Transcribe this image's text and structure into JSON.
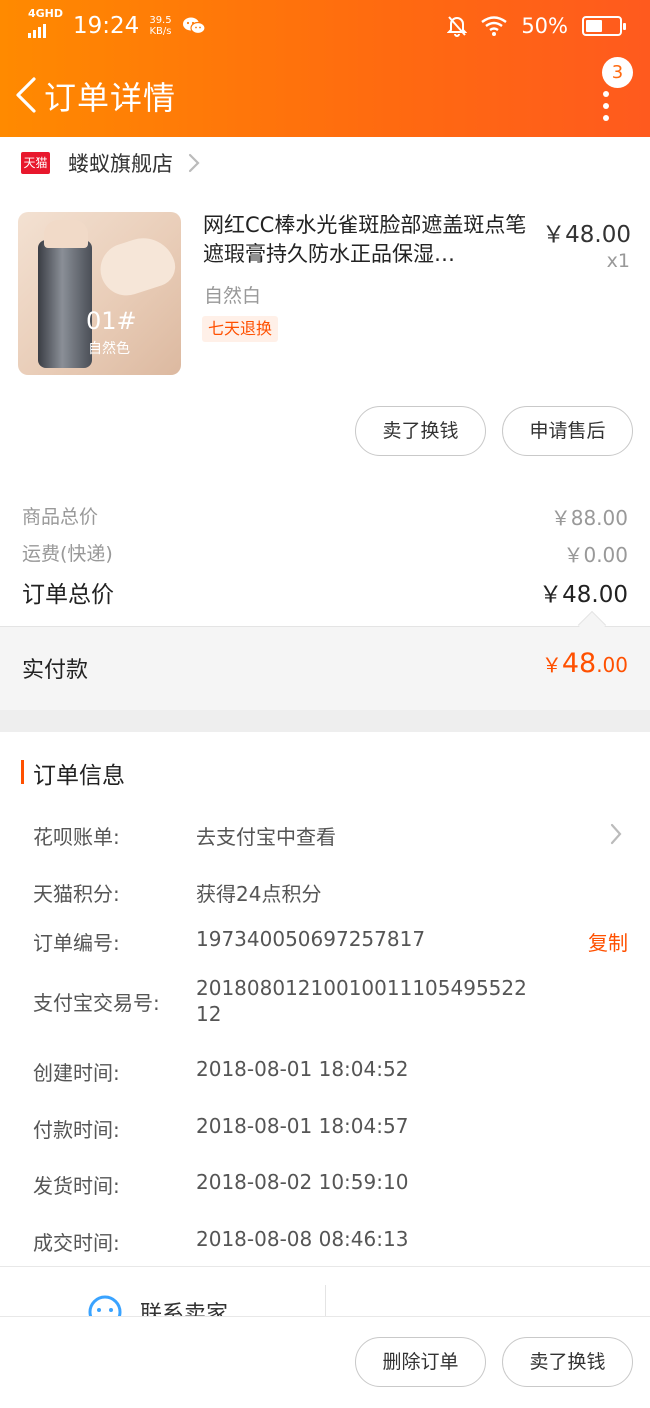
{
  "status_bar": {
    "network": "4GHD",
    "time": "19:24",
    "speed": "39.5",
    "speed_unit": "KB/s",
    "battery": "50%",
    "battery_level": 0.5
  },
  "header": {
    "title": "订单详情",
    "badge_count": "3"
  },
  "shop": {
    "badge": "天猫",
    "name": "蝼蚁旗舰店"
  },
  "product": {
    "image_number": "01#",
    "image_shade": "自然色",
    "title": "网红CC棒水光雀斑脸部遮盖斑点笔遮瑕膏持久防水正品保湿…",
    "price": "￥48.00",
    "quantity": "x1",
    "spec": "自然白",
    "tag": "七天退换"
  },
  "product_actions": {
    "sell": "卖了换钱",
    "after_sale": "申请售后"
  },
  "summary": {
    "goods_total_label": "商品总价",
    "goods_total_value": "￥88.00",
    "shipping_label": "运费(快递)",
    "shipping_value": "￥0.00",
    "order_total_label": "订单总价",
    "order_total_value": "￥48.00",
    "paid_label": "实付款",
    "paid_currency": "￥",
    "paid_int": "48",
    "paid_dec": ".00"
  },
  "order_info": {
    "title": "订单信息",
    "rows": [
      {
        "label": "花呗账单:",
        "value": "去支付宝中查看"
      },
      {
        "label": "天猫积分:",
        "value": "获得24点积分"
      },
      {
        "label": "订单编号:",
        "value": "197340050697257817"
      },
      {
        "label": "支付宝交易号:",
        "value": "20180801210010011105495522 12"
      },
      {
        "label": "创建时间:",
        "value": "2018-08-01 18:04:52"
      },
      {
        "label": "付款时间:",
        "value": "2018-08-01 18:04:57"
      },
      {
        "label": "发货时间:",
        "value": "2018-08-02 10:59:10"
      },
      {
        "label": "成交时间:",
        "value": "2018-08-08 08:46:13"
      }
    ],
    "copy": "复制"
  },
  "contact": {
    "label": "联系卖家"
  },
  "bottom_bar": {
    "delete": "删除订单",
    "sell": "卖了换钱"
  }
}
